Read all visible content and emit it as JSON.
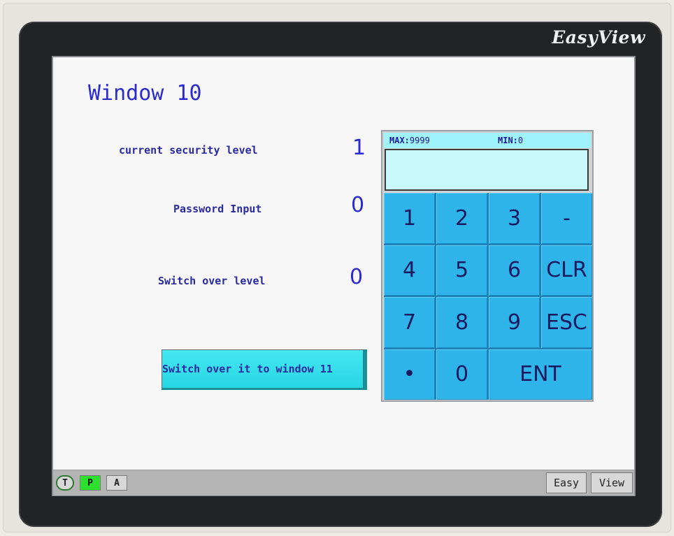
{
  "device": {
    "brand": "EasyView"
  },
  "window": {
    "title": "Window 10"
  },
  "fields": [
    {
      "label": "current security level",
      "value": "1"
    },
    {
      "label": "Password Input",
      "value": "0"
    },
    {
      "label": "Switch over level",
      "value": "0"
    }
  ],
  "switch_button": {
    "label": "Switch over it to window 11"
  },
  "keypad": {
    "max_label": "MAX:",
    "max_value": "9999",
    "min_label": "MIN:",
    "min_value": "0",
    "display_value": "",
    "keys": [
      "1",
      "2",
      "3",
      "-",
      "4",
      "5",
      "6",
      "CLR",
      "7",
      "8",
      "9",
      "ESC",
      "•",
      "0",
      "ENT"
    ]
  },
  "statusbar": {
    "t": "T",
    "p": "P",
    "a": "A",
    "easy": "Easy",
    "view": "View"
  },
  "colors": {
    "text_blue": "#2a2ad0",
    "keypad_key": "#2fb4ea",
    "button_cyan": "#27d6e2",
    "status_green": "#2ee02e"
  }
}
